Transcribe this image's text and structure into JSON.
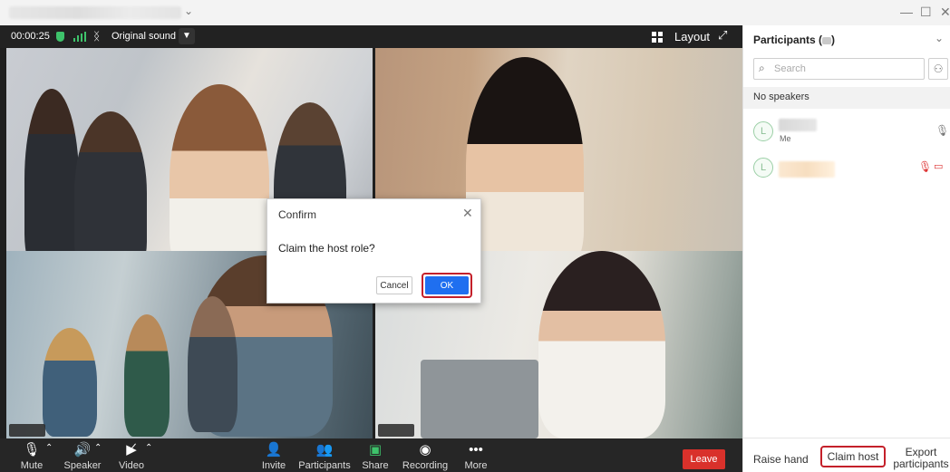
{
  "window": {
    "minimize": "—",
    "maximize": "☐",
    "close": "✕",
    "title_chevron": "⌄"
  },
  "topbar": {
    "timer": "00:00:25",
    "original_sound": "Original sound",
    "layout": "Layout"
  },
  "dialog": {
    "title": "Confirm",
    "message": "Claim the host role?",
    "cancel": "Cancel",
    "ok": "OK"
  },
  "toolbar": {
    "mute": "Mute",
    "speaker": "Speaker",
    "video": "Video",
    "invite": "Invite",
    "participants": "Participants",
    "share": "Share",
    "recording": "Recording",
    "more": "More",
    "leave": "Leave"
  },
  "panel": {
    "title": "Participants (",
    "title_close": ")",
    "search_placeholder": "Search",
    "no_speakers": "No speakers",
    "participants": [
      {
        "tag": "Me",
        "avatar": "L"
      },
      {
        "tag": "",
        "avatar": "L"
      }
    ],
    "raise_hand": "Raise hand",
    "claim_host": "Claim host",
    "export_line1": "Export",
    "export_line2": "participants"
  },
  "colors": {
    "leave": "#d9312b",
    "ok": "#1f6ff0",
    "highlight": "#c4202a",
    "status_green": "#3ec36b"
  }
}
